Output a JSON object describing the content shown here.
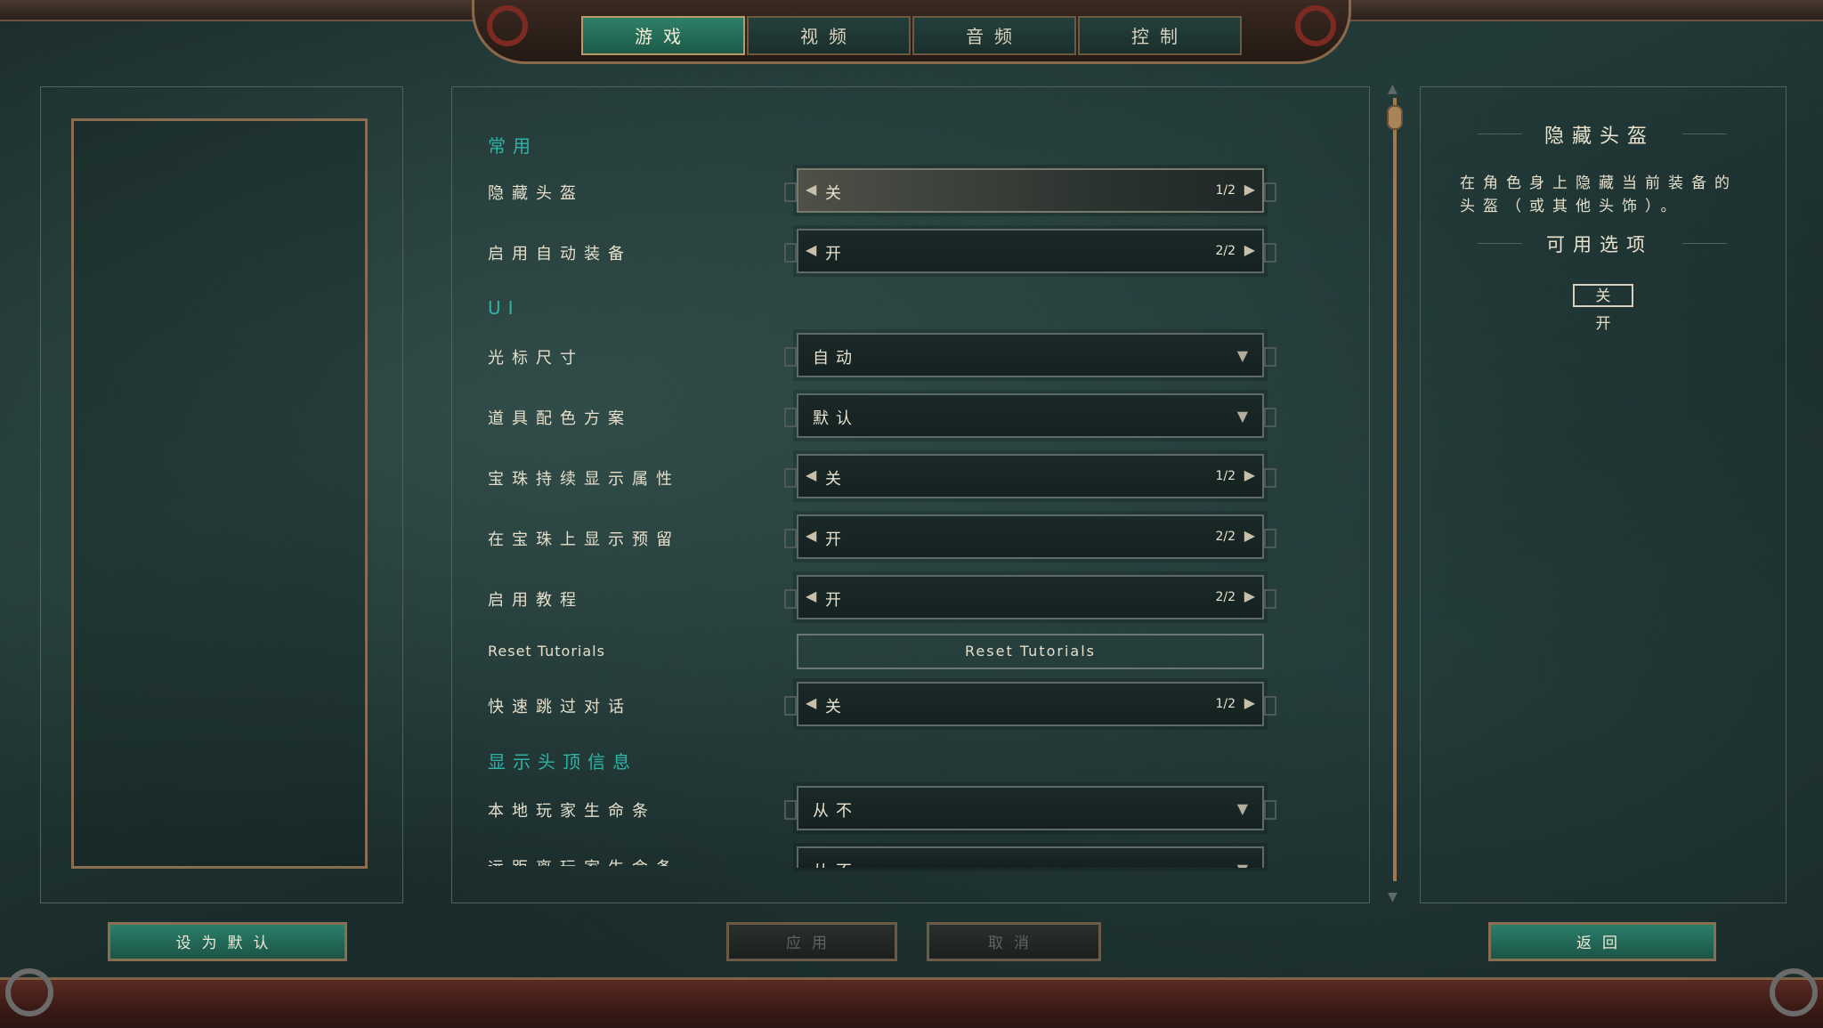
{
  "tabs": [
    {
      "label": "游戏",
      "active": true
    },
    {
      "label": "视频",
      "active": false
    },
    {
      "label": "音频",
      "active": false
    },
    {
      "label": "控制",
      "active": false
    }
  ],
  "sections": {
    "common": "常用",
    "ui": "UI",
    "overhead": "显示头顶信息"
  },
  "settings": {
    "hide_helmet": {
      "label": "隐藏头盔",
      "value": "关",
      "count": "1/2"
    },
    "auto_equip": {
      "label": "启用自动装备",
      "value": "开",
      "count": "2/2"
    },
    "cursor_size": {
      "label": "光标尺寸",
      "value": "自动"
    },
    "item_color_scheme": {
      "label": "道具配色方案",
      "value": "默认"
    },
    "orb_attributes": {
      "label": "宝珠持续显示属性",
      "value": "关",
      "count": "1/2"
    },
    "orb_reserve": {
      "label": "在宝珠上显示预留",
      "value": "开",
      "count": "2/2"
    },
    "tutorials": {
      "label": "启用教程",
      "value": "开",
      "count": "2/2"
    },
    "reset_tutorials": {
      "label": "Reset Tutorials",
      "button": "Reset Tutorials"
    },
    "fast_skip_dialog": {
      "label": "快速跳过对话",
      "value": "关",
      "count": "1/2"
    },
    "local_health_bar": {
      "label": "本地玩家生命条",
      "value": "从不"
    },
    "remote_health_bar": {
      "label": "远距离玩家生命条",
      "value": "从不"
    }
  },
  "info_panel": {
    "title": "隐藏头盔",
    "description": "在角色身上隐藏当前装备的头盔（或其他头饰）。",
    "options_title": "可用选项",
    "options": [
      "关",
      "开"
    ],
    "selected_option": "关"
  },
  "buttons": {
    "set_default": "设为默认",
    "apply": "应用",
    "cancel": "取消",
    "back": "返回"
  },
  "colors": {
    "accent_teal": "#2fb3a6",
    "active_tab": "#2e8068",
    "frame_gold": "#8a6e52"
  }
}
